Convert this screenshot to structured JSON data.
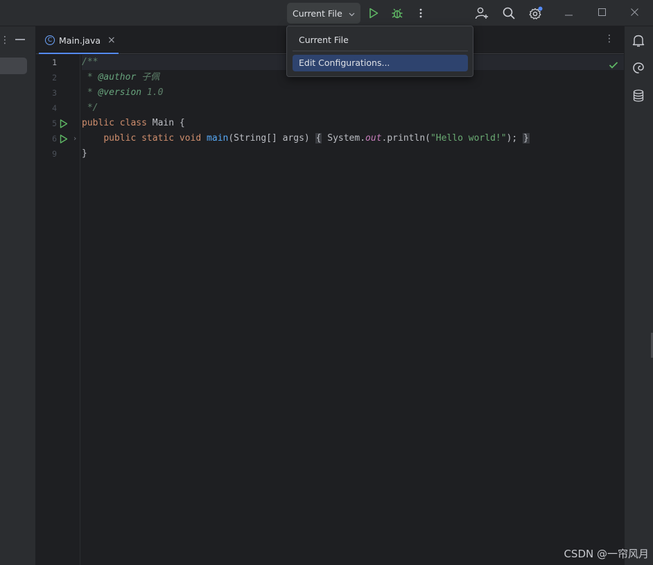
{
  "titlebar": {
    "run_config_label": "Current File",
    "icons": [
      "run-icon",
      "debug-icon",
      "more-vertical-icon",
      "add-user-icon",
      "search-icon",
      "settings-icon"
    ],
    "window_controls": [
      "minimize-icon",
      "maximize-icon",
      "close-icon"
    ]
  },
  "tabs": [
    {
      "label": "Main.java",
      "icon": "C",
      "active": true
    }
  ],
  "editor": {
    "line_numbers": [
      "1",
      "2",
      "3",
      "4",
      "5",
      "6",
      "9"
    ],
    "current_line": "1"
  },
  "code": {
    "l1": "/**",
    "l2_prefix": " * ",
    "l2_tag": "@author",
    "l2_text": " 子佩",
    "l3_prefix": " * ",
    "l3_tag": "@version",
    "l3_text": " 1.0",
    "l4": " */",
    "l5_kw1": "public",
    "l5_kw2": "class",
    "l5_rest": " Main {",
    "l6_indent": "    ",
    "l6_kw1": "public",
    "l6_kw2": "static",
    "l6_kw3": "void",
    "l6_fn": "main",
    "l6_params": "(String[] args)",
    "l6_lbrace": "{",
    "l6_sys": " System.",
    "l6_out": "out",
    "l6_println": ".println(",
    "l6_str": "\"Hello world!\"",
    "l6_end": "); ",
    "l6_rbrace": "}",
    "l9": "}"
  },
  "popup": {
    "items": [
      {
        "label": "Current File"
      },
      {
        "label": "Edit Configurations...",
        "selected": true
      }
    ]
  },
  "colors": {
    "accent": "#548af7",
    "run_green": "#5fb865",
    "selection": "#2e436e"
  },
  "watermark": "CSDN @一帘风月"
}
